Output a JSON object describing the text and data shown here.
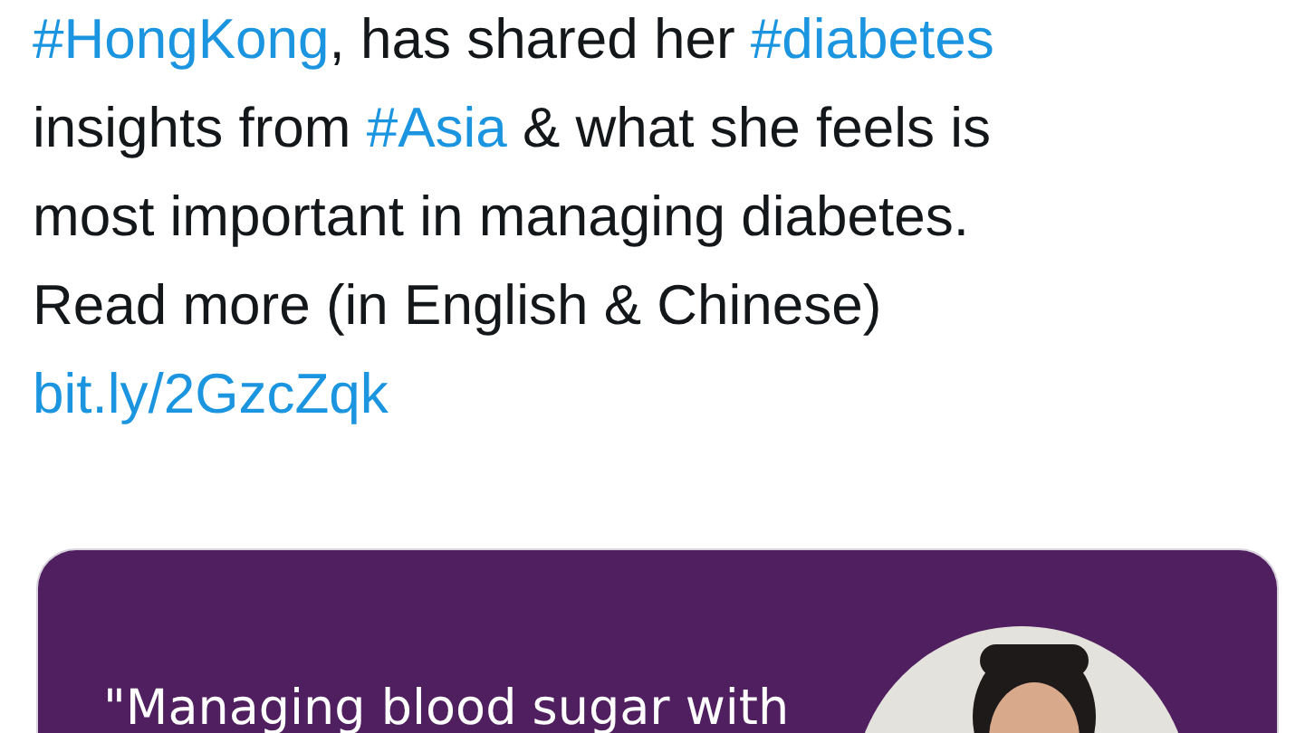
{
  "tweet": {
    "lines": [
      [
        {
          "kind": "hashtag",
          "text": "#HongKong"
        },
        {
          "kind": "plain",
          "text": ", has shared her "
        },
        {
          "kind": "hashtag",
          "text": "#diabetes"
        }
      ],
      [
        {
          "kind": "plain",
          "text": "insights from "
        },
        {
          "kind": "hashtag",
          "text": "#Asia"
        },
        {
          "kind": "plain",
          "text": " & what she feels is"
        }
      ],
      [
        {
          "kind": "plain",
          "text": "most important in managing diabetes."
        }
      ],
      [
        {
          "kind": "plain",
          "text": "Read more (in English & Chinese)"
        }
      ],
      [
        {
          "kind": "link",
          "text": "bit.ly/2GzcZqk"
        }
      ]
    ]
  },
  "card": {
    "quote": "\"Managing blood sugar with"
  }
}
